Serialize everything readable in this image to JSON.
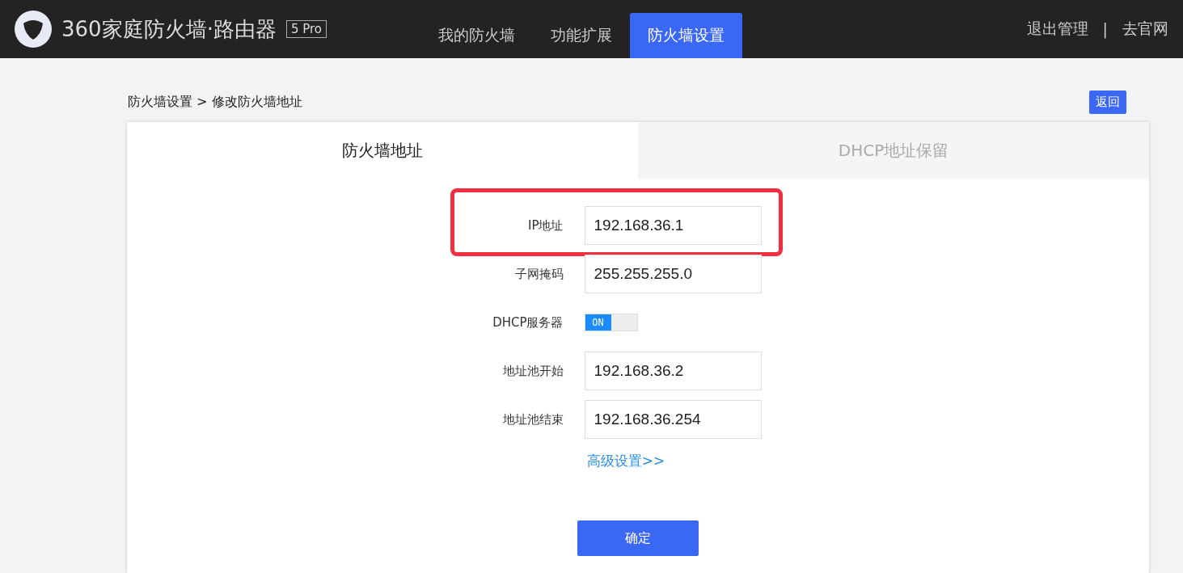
{
  "header": {
    "brand": "360家庭防火墙·路由器",
    "badge": "5 Pro",
    "nav": [
      {
        "label": "我的防火墙",
        "selected": false
      },
      {
        "label": "功能扩展",
        "selected": false
      },
      {
        "label": "防火墙设置",
        "selected": true
      }
    ],
    "links": [
      "退出管理",
      "去官网"
    ],
    "separator": "|"
  },
  "breadcrumb": "防火墙设置 > 修改防火墙地址",
  "back_button": "返回",
  "tabs": [
    {
      "label": "防火墙地址",
      "selected": true
    },
    {
      "label": "DHCP地址保留",
      "selected": false
    }
  ],
  "fields": [
    {
      "kind": "input",
      "label": "IP地址",
      "value": "192.168.36.1",
      "highlighted": true
    },
    {
      "kind": "input",
      "label": "子网掩码",
      "value": "255.255.255.0",
      "highlighted": false
    },
    {
      "kind": "toggle",
      "label": "DHCP服务器",
      "on": true,
      "toggle_text": "ON",
      "highlighted": false
    },
    {
      "kind": "input",
      "label": "地址池开始",
      "value": "192.168.36.2",
      "highlighted": false
    },
    {
      "kind": "input",
      "label": "地址池结束",
      "value": "192.168.36.254",
      "highlighted": false
    }
  ],
  "advanced_link": "高级设置>>",
  "confirm_button": "确定"
}
